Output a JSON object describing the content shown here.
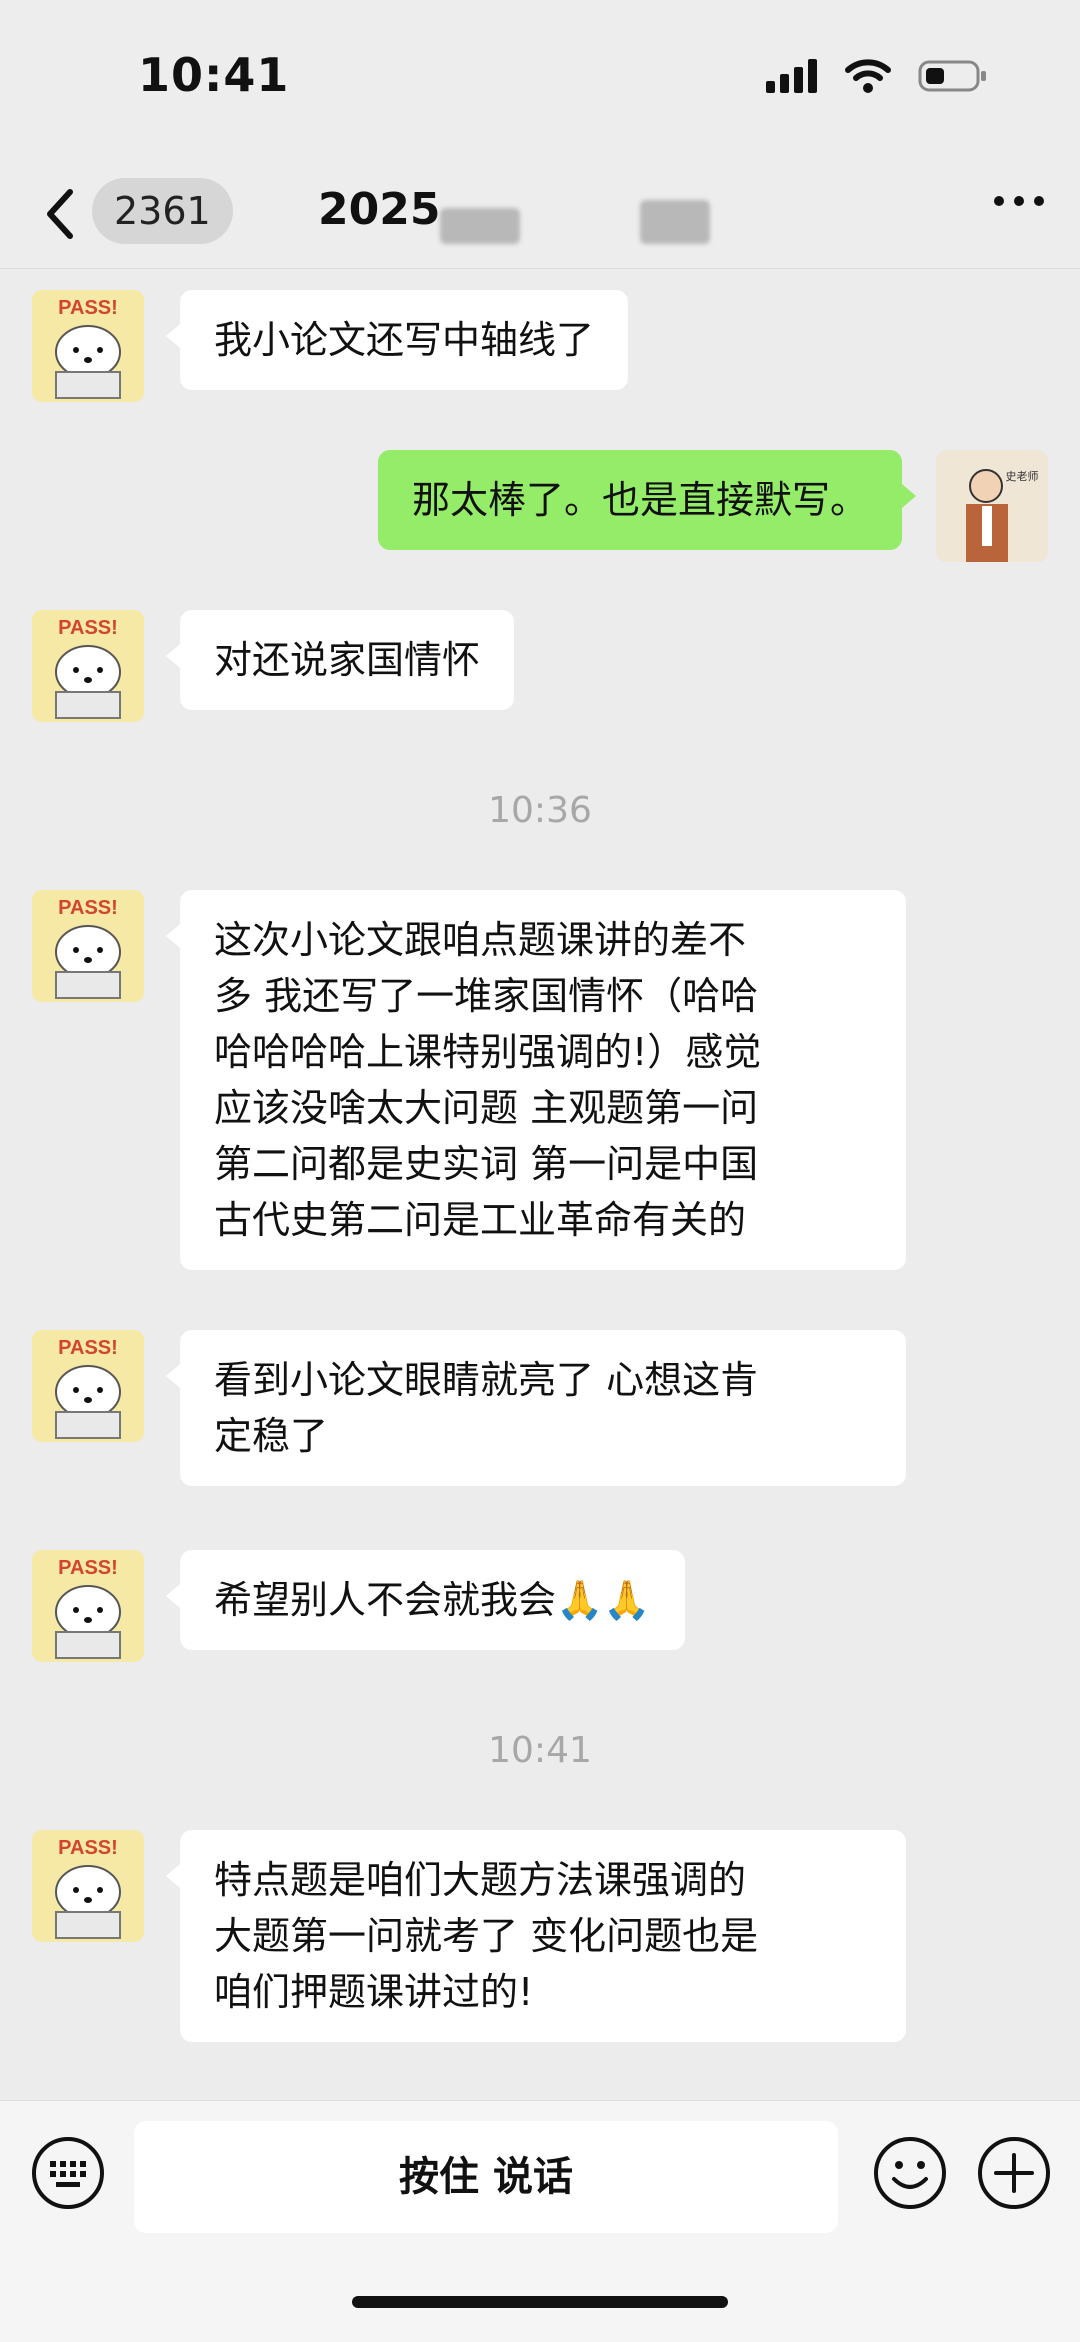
{
  "status_bar": {
    "time": "10:41"
  },
  "header": {
    "unread_count": "2361",
    "title": "2025"
  },
  "messages": [
    {
      "sender": "other",
      "text": "我小论文还写中轴线了"
    },
    {
      "sender": "me",
      "text": "那太棒了。也是直接默写。"
    },
    {
      "sender": "other",
      "text": "对还说家国情怀"
    },
    {
      "type": "time",
      "text": "10:36"
    },
    {
      "sender": "other",
      "lines": [
        "这次小论文跟咱点题课讲的差不",
        "多 我还写了一堆家国情怀（哈哈",
        "哈哈哈哈上课特别强调的!）感觉",
        "应该没啥太大问题 主观题第一问",
        "第二问都是史实词 第一问是中国",
        "古代史第二问是工业革命有关的"
      ]
    },
    {
      "sender": "other",
      "lines": [
        "看到小论文眼睛就亮了 心想这肯",
        "定稳了"
      ]
    },
    {
      "sender": "other",
      "text": "希望别人不会就我会🙏🙏"
    },
    {
      "type": "time",
      "text": "10:41"
    },
    {
      "sender": "other",
      "lines": [
        "特点题是咱们大题方法课强调的",
        "大题第一问就考了 变化问题也是",
        "咱们押题课讲过的!"
      ]
    }
  ],
  "avatar_other": {
    "badge_text": "PASS!"
  },
  "avatar_me": {
    "caption": "史老师"
  },
  "input_bar": {
    "hold_to_talk": "按住 说话"
  }
}
